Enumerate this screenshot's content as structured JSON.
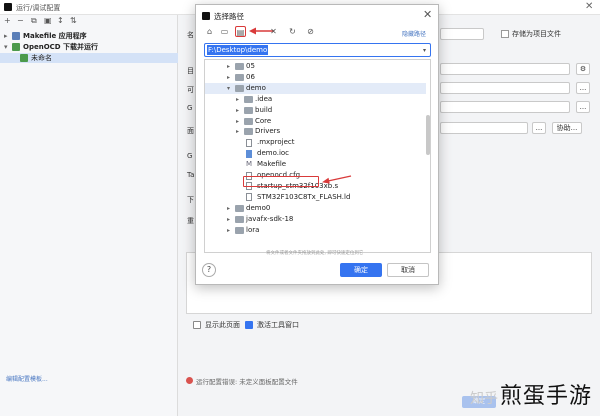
{
  "window": {
    "title": "运行/调试配置",
    "close_glyph": "✕"
  },
  "left": {
    "toolbar": [
      "+",
      "−",
      "⧉",
      "▣",
      "↕",
      "⇅"
    ],
    "tree": [
      {
        "label": "Makefile 应用程序",
        "bold": true,
        "arrow": "▸",
        "color": "#5b7fb8"
      },
      {
        "label": "OpenOCD 下载并运行",
        "bold": true,
        "arrow": "▾",
        "color": "#4c9a4c"
      },
      {
        "label": "未命名",
        "bold": false,
        "arrow": "",
        "color": "#4c9a4c"
      }
    ],
    "edit_templates_link": "编辑配置模板..."
  },
  "right": {
    "labels": [
      "名",
      "目",
      "可",
      "G",
      "面",
      "G",
      "Ta",
      "下",
      "重"
    ],
    "store_as_project_file": "存储为项目文件",
    "btn_ellipsis": "...",
    "btn_assist": "协助...",
    "show_page": "显示此页面",
    "activate_tool_window": "激活工具窗口",
    "error_text": "运行配置错误: 未定义面板配置文件",
    "ok_faded": "确定"
  },
  "dialog": {
    "title": "选择路径",
    "close_glyph": "✕",
    "toolbar_icons": [
      "home-icon",
      "desktop-icon",
      "new-folder-icon",
      "delete-icon",
      "refresh-icon",
      "link-icon"
    ],
    "toolbar_glyphs": [
      "⌂",
      "▭",
      "▤",
      "✕",
      "↻",
      "⊘"
    ],
    "hide_path_link": "隐藏路径",
    "path_value": "F:\\Desktop\\demo",
    "dropdown_glyph": "▾",
    "tree": [
      {
        "label": "05",
        "type": "folder",
        "arrow": "▸",
        "level": 1
      },
      {
        "label": "06",
        "type": "folder",
        "arrow": "▸",
        "level": 1
      },
      {
        "label": "demo",
        "type": "folder",
        "arrow": "▾",
        "level": 1,
        "selected": true
      },
      {
        "label": ".idea",
        "type": "folder",
        "arrow": "▸",
        "level": 2
      },
      {
        "label": "build",
        "type": "folder",
        "arrow": "▸",
        "level": 2
      },
      {
        "label": "Core",
        "type": "folder",
        "arrow": "▸",
        "level": 2
      },
      {
        "label": "Drivers",
        "type": "folder",
        "arrow": "▸",
        "level": 2
      },
      {
        "label": ".mxproject",
        "type": "file",
        "arrow": "",
        "level": 2
      },
      {
        "label": "demo.ioc",
        "type": "file-blue",
        "arrow": "",
        "level": 2
      },
      {
        "label": "Makefile",
        "type": "makefile",
        "arrow": "",
        "level": 2
      },
      {
        "label": "openocd.cfg",
        "type": "file",
        "arrow": "",
        "level": 2,
        "highlighted": true
      },
      {
        "label": "startup_stm32f103xb.s",
        "type": "file",
        "arrow": "",
        "level": 2
      },
      {
        "label": "STM32F103C8Tx_FLASH.ld",
        "type": "file",
        "arrow": "",
        "level": 2
      },
      {
        "label": "demo0",
        "type": "folder",
        "arrow": "▸",
        "level": 1
      },
      {
        "label": "javafx-sdk-18",
        "type": "folder",
        "arrow": "▸",
        "level": 1
      },
      {
        "label": "lora",
        "type": "folder",
        "arrow": "▸",
        "level": 1
      }
    ],
    "drag_hint": "将文件或者文件夹拖放到此处, 即可快速定位到它",
    "help": "?",
    "ok": "确定",
    "cancel": "取消"
  },
  "watermark": {
    "zhihu": "知乎",
    "brand": "煎蛋手游"
  },
  "colors": {
    "accent": "#3574f0",
    "annotation_red": "#d93a3a"
  }
}
